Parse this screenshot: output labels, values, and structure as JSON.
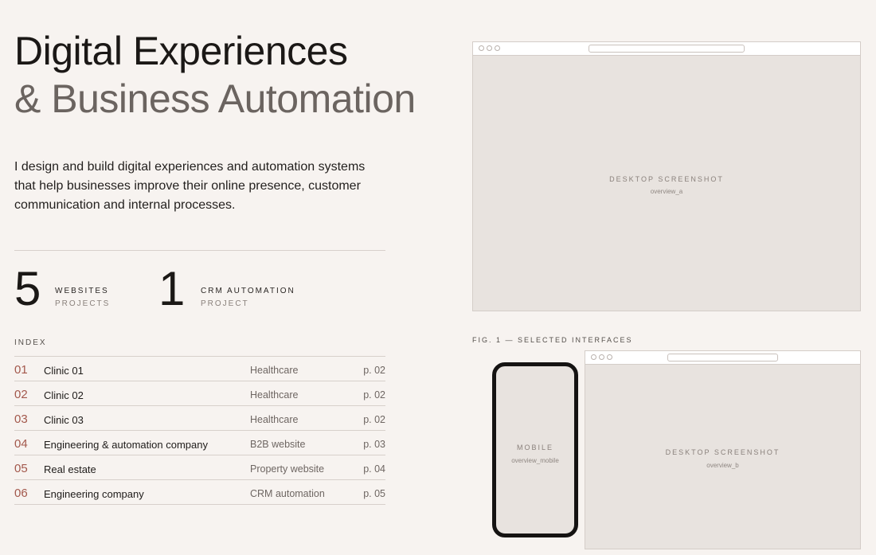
{
  "hero": {
    "title_line1": "Digital Experiences",
    "title_line2": "& Business Automation",
    "intro": "I design and build digital experiences and automation systems that help businesses improve their online presence, customer communication and internal processes."
  },
  "stats": [
    {
      "number": "5",
      "label": "WEBSITES",
      "sublabel": "PROJECTS"
    },
    {
      "number": "1",
      "label": "CRM AUTOMATION",
      "sublabel": "PROJECT"
    }
  ],
  "index": {
    "label": "INDEX",
    "rows": [
      {
        "num": "01",
        "name": "Clinic 01",
        "category": "Healthcare",
        "page": "p. 02"
      },
      {
        "num": "02",
        "name": "Clinic 02",
        "category": "Healthcare",
        "page": "p. 02"
      },
      {
        "num": "03",
        "name": "Clinic 03",
        "category": "Healthcare",
        "page": "p. 02"
      },
      {
        "num": "04",
        "name": "Engineering & automation company",
        "category": "B2B website",
        "page": "p. 03"
      },
      {
        "num": "05",
        "name": "Real estate",
        "category": "Property website",
        "page": "p. 04"
      },
      {
        "num": "06",
        "name": "Engineering company",
        "category": "CRM automation",
        "page": "p. 05"
      }
    ]
  },
  "mockups": {
    "desktop_a": {
      "label": "DESKTOP SCREENSHOT",
      "sub": "overview_a"
    },
    "caption": "FIG. 1 — SELECTED INTERFACES",
    "mobile": {
      "label": "MOBILE",
      "sub": "overview_mobile"
    },
    "desktop_b": {
      "label": "DESKTOP SCREENSHOT",
      "sub": "overview_b"
    }
  },
  "colors": {
    "background": "#f7f3f0",
    "accent_number": "#a3584c",
    "placeholder": "#e8e3df"
  }
}
